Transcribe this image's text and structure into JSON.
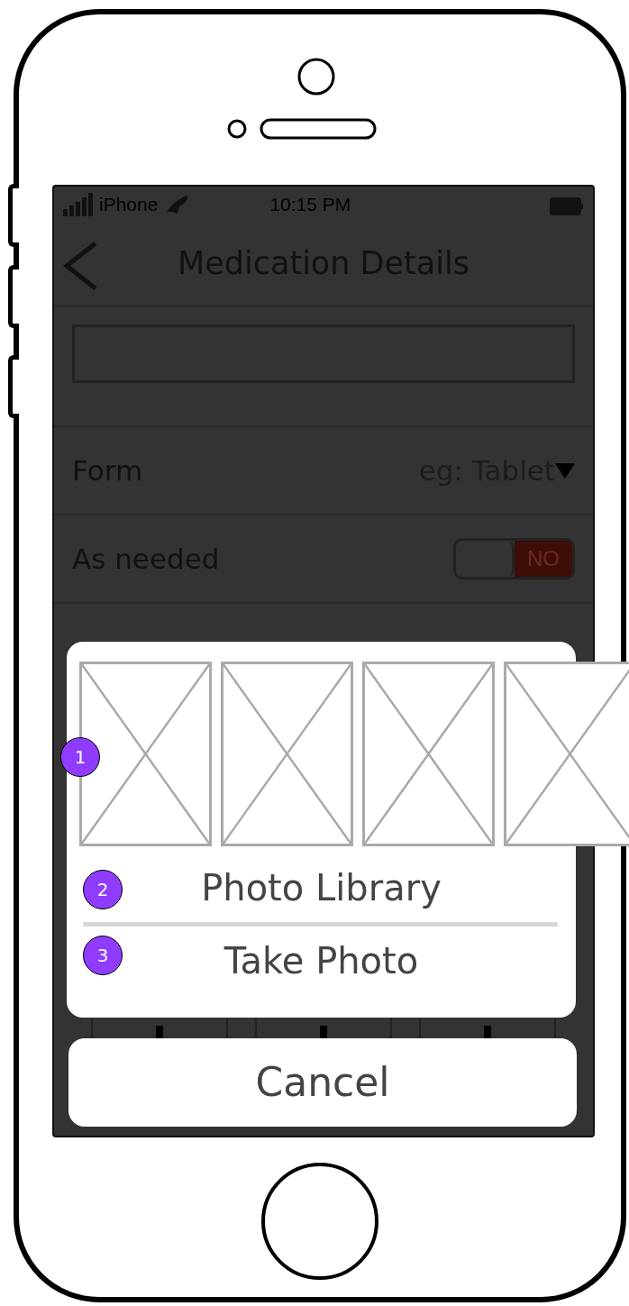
{
  "status_bar": {
    "carrier": "iPhone",
    "time": "10:15 PM"
  },
  "nav": {
    "title": "Medication Details"
  },
  "rows": [
    {
      "kind": "select",
      "label": "Form",
      "placeholder": "eg: Tablet"
    },
    {
      "kind": "toggle",
      "label": "As needed",
      "on": false,
      "toggle_label": "NO"
    }
  ],
  "action_sheet": {
    "photos_marker": "1",
    "actions": [
      {
        "label": "Photo Library",
        "marker": "2"
      },
      {
        "label": "Take Photo",
        "marker": "3"
      }
    ],
    "cancel": "Cancel"
  }
}
